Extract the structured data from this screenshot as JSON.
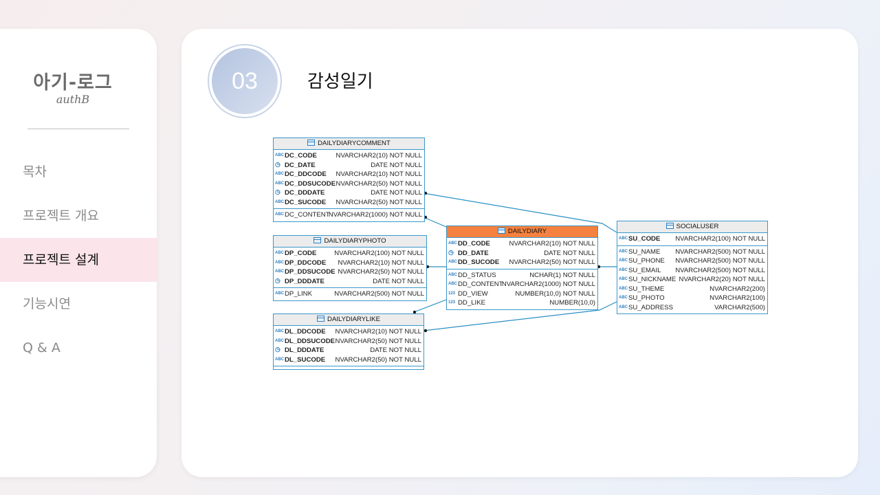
{
  "sidebar": {
    "logo_main": "아기-로그",
    "logo_sub": "authB",
    "nav": [
      {
        "label": "목차",
        "active": false
      },
      {
        "label": "프로젝트 개요",
        "active": false
      },
      {
        "label": "프로젝트 설계",
        "active": true
      },
      {
        "label": "기능시연",
        "active": false
      },
      {
        "label": "Q & A",
        "active": false
      }
    ]
  },
  "main": {
    "section_number": "03",
    "title": "감성일기"
  },
  "diagram": {
    "tables": [
      {
        "name": "DAILYDIARYCOMMENT",
        "header_color": "#ececec",
        "pk_fields": [
          {
            "icon": "ABC",
            "name": "DC_CODE",
            "type": "NVARCHAR2(10) NOT NULL"
          },
          {
            "icon": "clock",
            "name": "DC_DATE",
            "type": "DATE NOT NULL"
          },
          {
            "icon": "ABC",
            "name": "DC_DDCODE",
            "type": "NVARCHAR2(10) NOT NULL"
          },
          {
            "icon": "ABC",
            "name": "DC_DDSUCODE",
            "type": "NVARCHAR2(50) NOT NULL"
          },
          {
            "icon": "clock",
            "name": "DC_DDDATE",
            "type": "DATE NOT NULL"
          },
          {
            "icon": "ABC",
            "name": "DC_SUCODE",
            "type": "NVARCHAR2(50) NOT NULL"
          }
        ],
        "fields": [
          {
            "icon": "ABC",
            "name": "DC_CONTENT",
            "type": "NVARCHAR2(1000) NOT NULL"
          }
        ]
      },
      {
        "name": "DAILYDIARYPHOTO",
        "header_color": "#ececec",
        "pk_fields": [
          {
            "icon": "ABC",
            "name": "DP_CODE",
            "type": "NVARCHAR2(100) NOT NULL"
          },
          {
            "icon": "ABC",
            "name": "DP_DDCODE",
            "type": "NVARCHAR2(10) NOT NULL"
          },
          {
            "icon": "ABC",
            "name": "DP_DDSUCODE",
            "type": "NVARCHAR2(50) NOT NULL"
          },
          {
            "icon": "clock",
            "name": "DP_DDDATE",
            "type": "DATE NOT NULL"
          }
        ],
        "fields": [
          {
            "icon": "ABC",
            "name": "DP_LINK",
            "type": "NVARCHAR2(500) NOT NULL"
          }
        ]
      },
      {
        "name": "DAILYDIARYLIKE",
        "header_color": "#ececec",
        "pk_fields": [
          {
            "icon": "ABC",
            "name": "DL_DDCODE",
            "type": "NVARCHAR2(10) NOT NULL"
          },
          {
            "icon": "ABC",
            "name": "DL_DDSUCODE",
            "type": "NVARCHAR2(50) NOT NULL"
          },
          {
            "icon": "clock",
            "name": "DL_DDDATE",
            "type": "DATE NOT NULL"
          },
          {
            "icon": "ABC",
            "name": "DL_SUCODE",
            "type": "NVARCHAR2(50) NOT NULL"
          }
        ],
        "fields": []
      },
      {
        "name": "DAILYDIARY",
        "header_color": "#f4813f",
        "pk_fields": [
          {
            "icon": "ABC",
            "name": "DD_CODE",
            "type": "NVARCHAR2(10) NOT NULL"
          },
          {
            "icon": "clock",
            "name": "DD_DATE",
            "type": "DATE NOT NULL"
          },
          {
            "icon": "ABC",
            "name": "DD_SUCODE",
            "type": "NVARCHAR2(50) NOT NULL"
          }
        ],
        "fields": [
          {
            "icon": "ABC",
            "name": "DD_STATUS",
            "type": "NCHAR(1) NOT NULL"
          },
          {
            "icon": "ABC",
            "name": "DD_CONTENT",
            "type": "NVARCHAR2(1000) NOT NULL"
          },
          {
            "icon": "123",
            "name": "DD_VIEW",
            "type": "NUMBER(10,0) NOT NULL"
          },
          {
            "icon": "123",
            "name": "DD_LIKE",
            "type": "NUMBER(10,0)"
          }
        ]
      },
      {
        "name": "SOCIALUSER",
        "header_color": "#ececec",
        "pk_fields": [
          {
            "icon": "ABC",
            "name": "SU_CODE",
            "type": "NVARCHAR2(100) NOT NULL"
          }
        ],
        "fields": [
          {
            "icon": "ABC",
            "name": "SU_NAME",
            "type": "NVARCHAR2(500) NOT NULL"
          },
          {
            "icon": "ABC",
            "name": "SU_PHONE",
            "type": "NVARCHAR2(500) NOT NULL"
          },
          {
            "icon": "ABC",
            "name": "SU_EMAIL",
            "type": "NVARCHAR2(500) NOT NULL"
          },
          {
            "icon": "ABC",
            "name": "SU_NICKNAME",
            "type": "NVARCHAR2(20) NOT NULL"
          },
          {
            "icon": "ABC",
            "name": "SU_THEME",
            "type": "NVARCHAR2(200)"
          },
          {
            "icon": "ABC",
            "name": "SU_PHOTO",
            "type": "NVARCHAR2(100)"
          },
          {
            "icon": "ABC",
            "name": "SU_ADDRESS",
            "type": "VARCHAR2(500)"
          }
        ]
      }
    ],
    "relationships": [
      {
        "from": "DAILYDIARYCOMMENT",
        "to": "SOCIALUSER"
      },
      {
        "from": "DAILYDIARYCOMMENT",
        "to": "DAILYDIARY"
      },
      {
        "from": "DAILYDIARYPHOTO",
        "to": "DAILYDIARY"
      },
      {
        "from": "DAILYDIARYLIKE",
        "to": "DAILYDIARY"
      },
      {
        "from": "DAILYDIARYLIKE",
        "to": "SOCIALUSER"
      },
      {
        "from": "DAILYDIARY",
        "to": "SOCIALUSER"
      }
    ],
    "line_color": "#2a8fc4"
  }
}
